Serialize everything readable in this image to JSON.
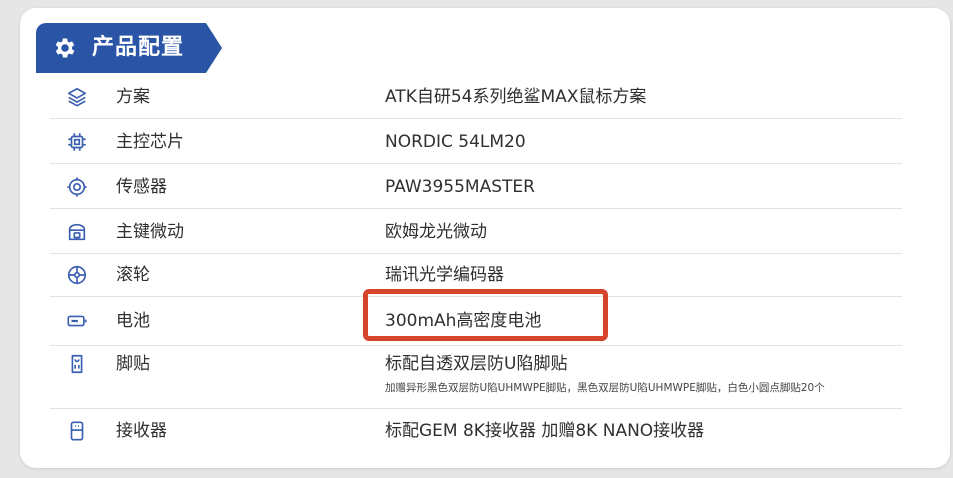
{
  "header": {
    "title": "产品配置",
    "icon": "gear-icon"
  },
  "rows": [
    {
      "label": "方案",
      "value": "ATK自研54系列绝鲨MAX鼠标方案",
      "icon": "layers-icon"
    },
    {
      "label": "主控芯片",
      "value": "NORDIC  54LM20",
      "icon": "chip-icon"
    },
    {
      "label": "传感器",
      "value": "PAW3955MASTER",
      "icon": "sensor-icon"
    },
    {
      "label": "主键微动",
      "value": "欧姆龙光微动",
      "icon": "switch-icon"
    },
    {
      "label": "滚轮",
      "value": "瑞讯光学编码器",
      "icon": "wheel-icon"
    },
    {
      "label": "电池",
      "value": "300mAh高密度电池",
      "icon": "battery-icon"
    },
    {
      "label": "脚贴",
      "value": "标配自透双层防U陷脚贴",
      "note": "加赠异形黑色双层防U陷UHMWPE脚贴，黑色双层防U陷UHMWPE脚贴，白色小圆点脚贴20个",
      "icon": "feet-icon"
    },
    {
      "label": "接收器",
      "value": "标配GEM 8K接收器   加赠8K NANO接收器",
      "icon": "receiver-icon"
    }
  ],
  "colors": {
    "header_bg": "#2a55a6",
    "accent_icon": "#3a5fb0",
    "highlight": "#d7442c"
  }
}
